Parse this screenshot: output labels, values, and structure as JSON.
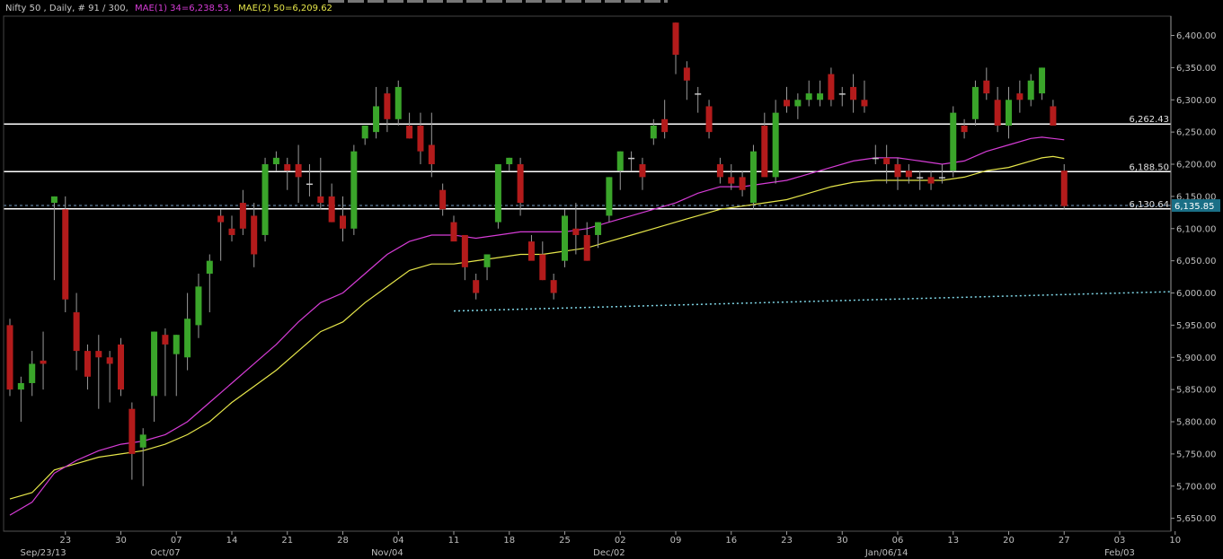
{
  "legend": {
    "title": "Nifty 50 , Daily, # 91 / 300,",
    "ma1": "MAE(1) 34=6,238.53,",
    "ma2": "MAE(2) 50=6,209.62"
  },
  "colors": {
    "background": "#000000",
    "up": "#3aa52a",
    "down": "#b31b1b",
    "doji": "#c8c8c8",
    "ma34": "#d63cd6",
    "ma50": "#e6e64a",
    "level": "#ffffff",
    "dotted": "#7fd6e6",
    "axis": "#9a9a9a",
    "price_badge": "#1a6f86"
  },
  "chart_data": {
    "type": "candlestick",
    "ylim": [
      5630,
      6430
    ],
    "yticks": [
      5650,
      5700,
      5750,
      5800,
      5850,
      5900,
      5950,
      6000,
      6050,
      6100,
      6150,
      6200,
      6250,
      6300,
      6350,
      6400
    ],
    "ytick_labels": [
      "5,650.00",
      "5,700.00",
      "5,750.00",
      "5,800.00",
      "5,850.00",
      "5,900.00",
      "5,950.00",
      "6,000.00",
      "6,050.00",
      "6,100.00",
      "6,150.00",
      "6,200.00",
      "6,250.00",
      "6,300.00",
      "6,350.00",
      "6,400.00"
    ],
    "xticks": [
      {
        "bar": 5,
        "label": "23"
      },
      {
        "bar": 10,
        "label": "30"
      },
      {
        "bar": 15,
        "label": "07"
      },
      {
        "bar": 20,
        "label": "14"
      },
      {
        "bar": 25,
        "label": "21"
      },
      {
        "bar": 30,
        "label": "28"
      },
      {
        "bar": 35,
        "label": "04"
      },
      {
        "bar": 40,
        "label": "11"
      },
      {
        "bar": 45,
        "label": "18"
      },
      {
        "bar": 50,
        "label": "25"
      },
      {
        "bar": 55,
        "label": "02"
      },
      {
        "bar": 60,
        "label": "09"
      },
      {
        "bar": 65,
        "label": "16"
      },
      {
        "bar": 70,
        "label": "23"
      },
      {
        "bar": 75,
        "label": "30"
      },
      {
        "bar": 80,
        "label": "06"
      },
      {
        "bar": 85,
        "label": "13"
      },
      {
        "bar": 90,
        "label": "20"
      },
      {
        "bar": 95,
        "label": "27"
      },
      {
        "bar": 100,
        "label": "03"
      },
      {
        "bar": 105,
        "label": "10"
      }
    ],
    "month_labels": [
      {
        "bar": 3,
        "label": "Sep/23/13"
      },
      {
        "bar": 14,
        "label": "Oct/07"
      },
      {
        "bar": 34,
        "label": "Nov/04"
      },
      {
        "bar": 54,
        "label": "Dec/02"
      },
      {
        "bar": 79,
        "label": "Jan/06/14"
      },
      {
        "bar": 100,
        "label": "Feb/03"
      }
    ],
    "candles": [
      [
        5950,
        5960,
        5840,
        5850
      ],
      [
        5850,
        5870,
        5800,
        5860
      ],
      [
        5860,
        5910,
        5840,
        5890
      ],
      [
        5895,
        5940,
        5850,
        5890
      ],
      [
        6140,
        6150,
        6020,
        6150
      ],
      [
        6130,
        6150,
        5970,
        5990
      ],
      [
        5970,
        6000,
        5880,
        5910
      ],
      [
        5910,
        5920,
        5850,
        5870
      ],
      [
        5910,
        5935,
        5820,
        5900
      ],
      [
        5900,
        5910,
        5830,
        5890
      ],
      [
        5920,
        5930,
        5840,
        5850
      ],
      [
        5820,
        5830,
        5710,
        5750
      ],
      [
        5760,
        5790,
        5700,
        5780
      ],
      [
        5840,
        5940,
        5800,
        5940
      ],
      [
        5935,
        5945,
        5840,
        5920
      ],
      [
        5905,
        5935,
        5840,
        5935
      ],
      [
        5900,
        6000,
        5880,
        5960
      ],
      [
        5950,
        6030,
        5930,
        6010
      ],
      [
        6030,
        6060,
        5970,
        6050
      ],
      [
        6120,
        6130,
        6050,
        6110
      ],
      [
        6100,
        6120,
        6080,
        6090
      ],
      [
        6140,
        6160,
        6090,
        6100
      ],
      [
        6120,
        6140,
        6040,
        6060
      ],
      [
        6090,
        6210,
        6080,
        6200
      ],
      [
        6200,
        6220,
        6190,
        6210
      ],
      [
        6200,
        6210,
        6160,
        6190
      ],
      [
        6200,
        6230,
        6140,
        6180
      ],
      [
        6170,
        6200,
        6150,
        6170
      ],
      [
        6150,
        6210,
        6130,
        6140
      ],
      [
        6150,
        6170,
        6110,
        6110
      ],
      [
        6120,
        6150,
        6080,
        6100
      ],
      [
        6100,
        6230,
        6090,
        6220
      ],
      [
        6240,
        6260,
        6230,
        6260
      ],
      [
        6250,
        6320,
        6240,
        6290
      ],
      [
        6310,
        6320,
        6250,
        6270
      ],
      [
        6270,
        6330,
        6260,
        6320
      ],
      [
        6260,
        6280,
        6240,
        6240
      ],
      [
        6260,
        6280,
        6200,
        6220
      ],
      [
        6230,
        6280,
        6180,
        6200
      ],
      [
        6160,
        6170,
        6120,
        6130
      ],
      [
        6110,
        6120,
        6090,
        6080
      ],
      [
        6090,
        6080,
        6020,
        6040
      ],
      [
        6020,
        6030,
        5990,
        6000
      ],
      [
        6040,
        6060,
        6020,
        6060
      ],
      [
        6110,
        6200,
        6100,
        6200
      ],
      [
        6200,
        6210,
        6190,
        6210
      ],
      [
        6200,
        6210,
        6120,
        6140
      ],
      [
        6080,
        6090,
        6060,
        6050
      ],
      [
        6060,
        6080,
        6020,
        6020
      ],
      [
        6020,
        6030,
        5990,
        6000
      ],
      [
        6050,
        6130,
        6040,
        6120
      ],
      [
        6100,
        6140,
        6060,
        6090
      ],
      [
        6090,
        6110,
        6050,
        6050
      ],
      [
        6090,
        6110,
        6070,
        6110
      ],
      [
        6120,
        6180,
        6110,
        6180
      ],
      [
        6190,
        6220,
        6160,
        6220
      ],
      [
        6210,
        6220,
        6190,
        6210
      ],
      [
        6200,
        6210,
        6160,
        6180
      ],
      [
        6240,
        6270,
        6230,
        6260
      ],
      [
        6270,
        6300,
        6240,
        6250
      ],
      [
        6420,
        6420,
        6340,
        6370
      ],
      [
        6350,
        6360,
        6300,
        6330
      ],
      [
        6310,
        6320,
        6280,
        6310
      ],
      [
        6290,
        6300,
        6240,
        6250
      ],
      [
        6200,
        6210,
        6170,
        6180
      ],
      [
        6180,
        6200,
        6160,
        6170
      ],
      [
        6180,
        6190,
        6150,
        6160
      ],
      [
        6140,
        6230,
        6130,
        6220
      ],
      [
        6260,
        6280,
        6200,
        6180
      ],
      [
        6180,
        6300,
        6170,
        6280
      ],
      [
        6300,
        6320,
        6280,
        6290
      ],
      [
        6290,
        6310,
        6270,
        6300
      ],
      [
        6300,
        6330,
        6290,
        6310
      ],
      [
        6300,
        6330,
        6290,
        6310
      ],
      [
        6340,
        6350,
        6290,
        6300
      ],
      [
        6310,
        6320,
        6290,
        6310
      ],
      [
        6320,
        6340,
        6280,
        6300
      ],
      [
        6300,
        6330,
        6280,
        6290
      ],
      [
        6210,
        6230,
        6200,
        6210
      ],
      [
        6210,
        6230,
        6170,
        6200
      ],
      [
        6200,
        6210,
        6160,
        6180
      ],
      [
        6190,
        6200,
        6170,
        6180
      ],
      [
        6180,
        6190,
        6160,
        6180
      ],
      [
        6180,
        6190,
        6160,
        6170
      ],
      [
        6180,
        6200,
        6170,
        6180
      ],
      [
        6190,
        6290,
        6180,
        6280
      ],
      [
        6260,
        6270,
        6240,
        6250
      ],
      [
        6270,
        6330,
        6260,
        6320
      ],
      [
        6330,
        6350,
        6300,
        6310
      ],
      [
        6300,
        6320,
        6250,
        6260
      ],
      [
        6260,
        6320,
        6240,
        6300
      ],
      [
        6310,
        6330,
        6280,
        6300
      ],
      [
        6300,
        6340,
        6290,
        6330
      ],
      [
        6310,
        6350,
        6300,
        6350
      ],
      [
        6290,
        6300,
        6260,
        6260
      ],
      [
        6190,
        6200,
        6130,
        6135
      ]
    ],
    "ma34": [
      [
        0,
        5655
      ],
      [
        2,
        5675
      ],
      [
        4,
        5720
      ],
      [
        6,
        5740
      ],
      [
        8,
        5755
      ],
      [
        10,
        5765
      ],
      [
        12,
        5770
      ],
      [
        14,
        5780
      ],
      [
        16,
        5800
      ],
      [
        18,
        5830
      ],
      [
        20,
        5860
      ],
      [
        22,
        5890
      ],
      [
        24,
        5920
      ],
      [
        26,
        5955
      ],
      [
        28,
        5985
      ],
      [
        30,
        6000
      ],
      [
        32,
        6030
      ],
      [
        34,
        6060
      ],
      [
        36,
        6080
      ],
      [
        38,
        6090
      ],
      [
        40,
        6090
      ],
      [
        42,
        6085
      ],
      [
        44,
        6090
      ],
      [
        46,
        6095
      ],
      [
        48,
        6095
      ],
      [
        50,
        6095
      ],
      [
        52,
        6100
      ],
      [
        54,
        6110
      ],
      [
        56,
        6120
      ],
      [
        58,
        6130
      ],
      [
        60,
        6140
      ],
      [
        62,
        6155
      ],
      [
        64,
        6165
      ],
      [
        66,
        6165
      ],
      [
        68,
        6170
      ],
      [
        70,
        6175
      ],
      [
        72,
        6185
      ],
      [
        74,
        6195
      ],
      [
        76,
        6205
      ],
      [
        78,
        6210
      ],
      [
        80,
        6210
      ],
      [
        82,
        6205
      ],
      [
        84,
        6200
      ],
      [
        86,
        6205
      ],
      [
        88,
        6220
      ],
      [
        90,
        6230
      ],
      [
        92,
        6240
      ],
      [
        93,
        6242
      ],
      [
        94,
        6240
      ],
      [
        95,
        6238
      ]
    ],
    "ma50": [
      [
        0,
        5680
      ],
      [
        2,
        5690
      ],
      [
        4,
        5725
      ],
      [
        6,
        5735
      ],
      [
        8,
        5745
      ],
      [
        10,
        5750
      ],
      [
        12,
        5755
      ],
      [
        14,
        5765
      ],
      [
        16,
        5780
      ],
      [
        18,
        5800
      ],
      [
        20,
        5830
      ],
      [
        22,
        5855
      ],
      [
        24,
        5880
      ],
      [
        26,
        5910
      ],
      [
        28,
        5940
      ],
      [
        30,
        5955
      ],
      [
        32,
        5985
      ],
      [
        34,
        6010
      ],
      [
        36,
        6035
      ],
      [
        38,
        6045
      ],
      [
        40,
        6045
      ],
      [
        42,
        6050
      ],
      [
        44,
        6055
      ],
      [
        46,
        6060
      ],
      [
        48,
        6060
      ],
      [
        50,
        6065
      ],
      [
        52,
        6070
      ],
      [
        54,
        6080
      ],
      [
        56,
        6090
      ],
      [
        58,
        6100
      ],
      [
        60,
        6110
      ],
      [
        62,
        6120
      ],
      [
        64,
        6130
      ],
      [
        66,
        6135
      ],
      [
        68,
        6140
      ],
      [
        70,
        6145
      ],
      [
        72,
        6155
      ],
      [
        74,
        6165
      ],
      [
        76,
        6172
      ],
      [
        78,
        6175
      ],
      [
        80,
        6175
      ],
      [
        82,
        6175
      ],
      [
        84,
        6175
      ],
      [
        86,
        6180
      ],
      [
        88,
        6190
      ],
      [
        90,
        6195
      ],
      [
        92,
        6205
      ],
      [
        93,
        6210
      ],
      [
        94,
        6212
      ],
      [
        95,
        6209
      ]
    ],
    "dotted_line": {
      "from_bar": 40,
      "to_bar": 110,
      "from_value": 5972,
      "to_value": 6002
    },
    "levels": [
      {
        "value": 6262.43,
        "label": "6,262.43"
      },
      {
        "value": 6188.5,
        "label": "6,188.50"
      },
      {
        "value": 6130.64,
        "label": "6,130.64"
      }
    ],
    "last_price": {
      "value": 6135.85,
      "label": "6,135.85"
    }
  }
}
